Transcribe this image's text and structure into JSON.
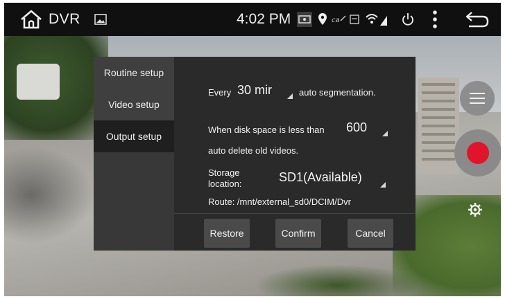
{
  "statusbar": {
    "app_title": "DVR",
    "clock": "4:02 PM",
    "icons": [
      "home-icon",
      "image-icon",
      "screen-icon",
      "location-icon",
      "signal-icon",
      "wifi-icon",
      "power-icon",
      "menu-dots-icon",
      "back-icon"
    ]
  },
  "tabs": {
    "items": [
      {
        "label": "Routine setup"
      },
      {
        "label": "Video setup"
      },
      {
        "label": "Output setup"
      }
    ],
    "active_index": 2
  },
  "settings": {
    "segment_prefix": "Every",
    "segment_value": "30 mir",
    "segment_suffix": "auto segmentation.",
    "disk_prefix": "When disk space is less than",
    "disk_value": "600",
    "disk_suffix": "auto delete old videos.",
    "storage_label_line1": "Storage",
    "storage_label_line2": "location:",
    "storage_value": "SD1(Available)",
    "route": "Route: /mnt/external_sd0/DCIM/Dvr"
  },
  "buttons": {
    "restore": "Restore",
    "confirm": "Confirm",
    "cancel": "Cancel"
  },
  "colors": {
    "record_red": "#e0152b",
    "panel_bg": "#2a2a2a",
    "statusbar_bg": "#101010"
  }
}
